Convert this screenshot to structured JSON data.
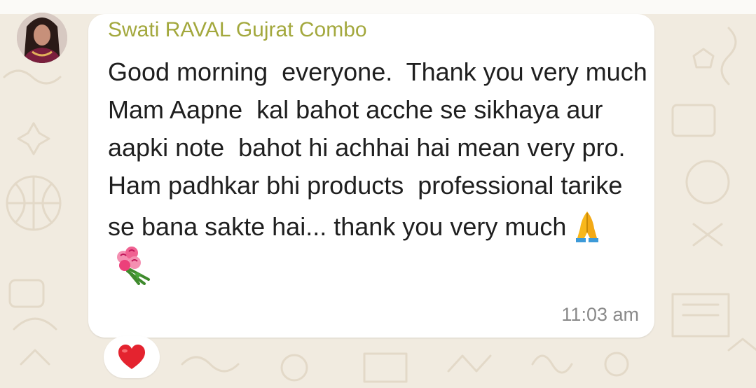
{
  "message": {
    "sender": "Swati RAVAL Gujrat Combo",
    "text": "Good morning  everyone.  Thank you very much  Mam Aapne  kal bahot acche se sikhaya aur aapki note  bahot hi achhai hai mean very pro.  Ham padhkar bhi products  professional tarike se bana sakte hai... thank you very much",
    "emojis": [
      "folded-hands-icon",
      "bouquet-icon"
    ],
    "time": "11:03 am"
  },
  "reactions": [
    {
      "icon": "red-heart-icon"
    }
  ],
  "colors": {
    "sender_name": "#a3a83d",
    "wallpaper": "#f1ebe0",
    "bubble": "#ffffff",
    "timestamp": "#8a8a8a",
    "heart": "#e4232f"
  }
}
